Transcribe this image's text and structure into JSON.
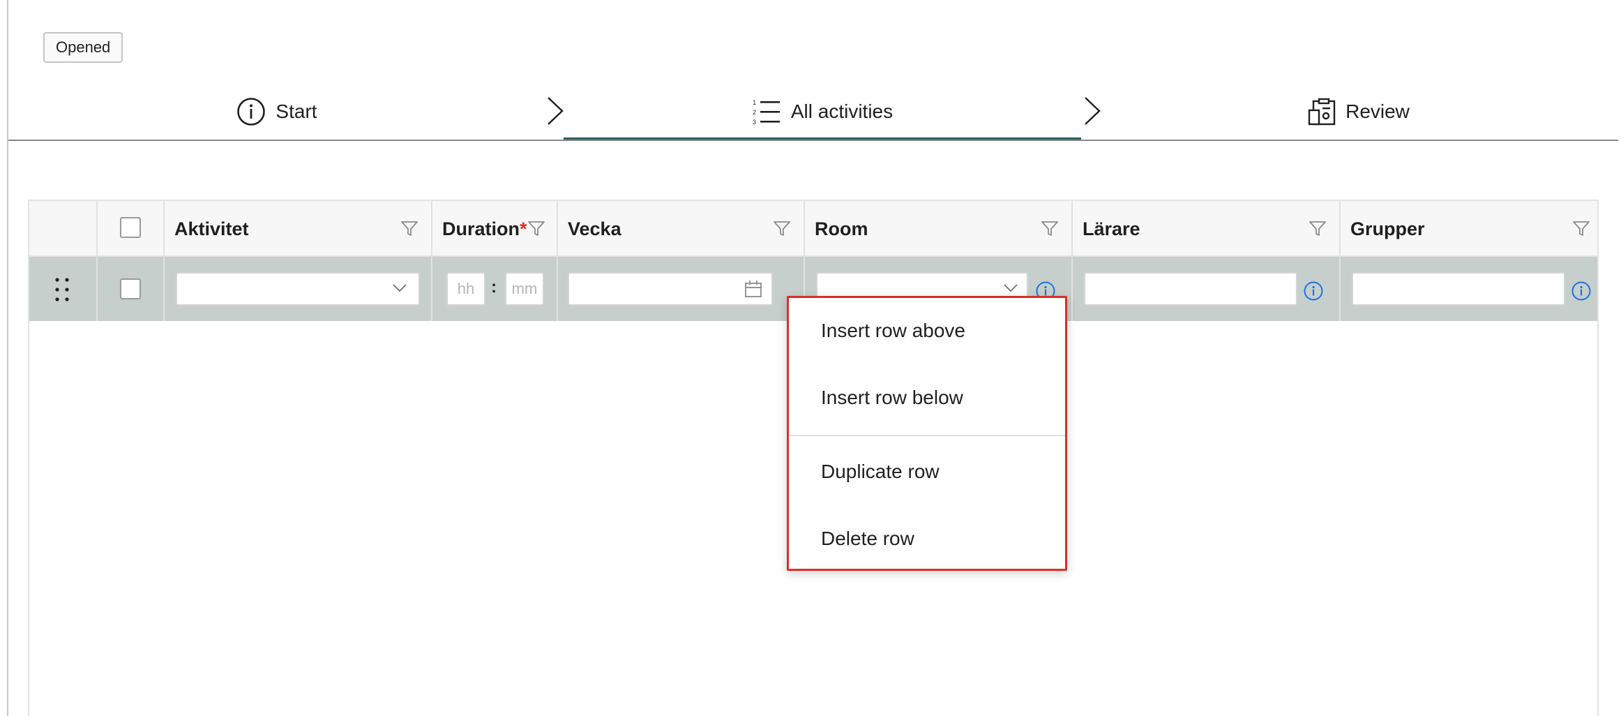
{
  "status_badge": "Opened",
  "stepper": {
    "steps": [
      {
        "label": "Start",
        "icon": "info-circle-icon"
      },
      {
        "label": "All activities",
        "icon": "numbered-list-icon",
        "active": true
      },
      {
        "label": "Review",
        "icon": "clipboard-review-icon"
      }
    ]
  },
  "grid": {
    "columns": [
      {
        "label": "Aktivitet",
        "filter": true
      },
      {
        "label": "Duration",
        "required_mark": "*",
        "filter": true
      },
      {
        "label": "Vecka",
        "filter": true
      },
      {
        "label": "Room",
        "filter": true
      },
      {
        "label": "Lärare",
        "filter": true
      },
      {
        "label": "Grupper",
        "filter": true
      }
    ],
    "row": {
      "duration_hours_placeholder": "hh",
      "duration_separator": ":",
      "duration_minutes_placeholder": "mm"
    }
  },
  "context_menu": {
    "items": [
      "Insert row above",
      "Insert row below",
      "Duplicate row",
      "Delete row"
    ]
  },
  "colors": {
    "active_step": "#2b5f5f",
    "selected_row": "#c6cfcc",
    "menu_border": "#d93025",
    "info_icon": "#1a73e8",
    "required": "#d93025"
  }
}
